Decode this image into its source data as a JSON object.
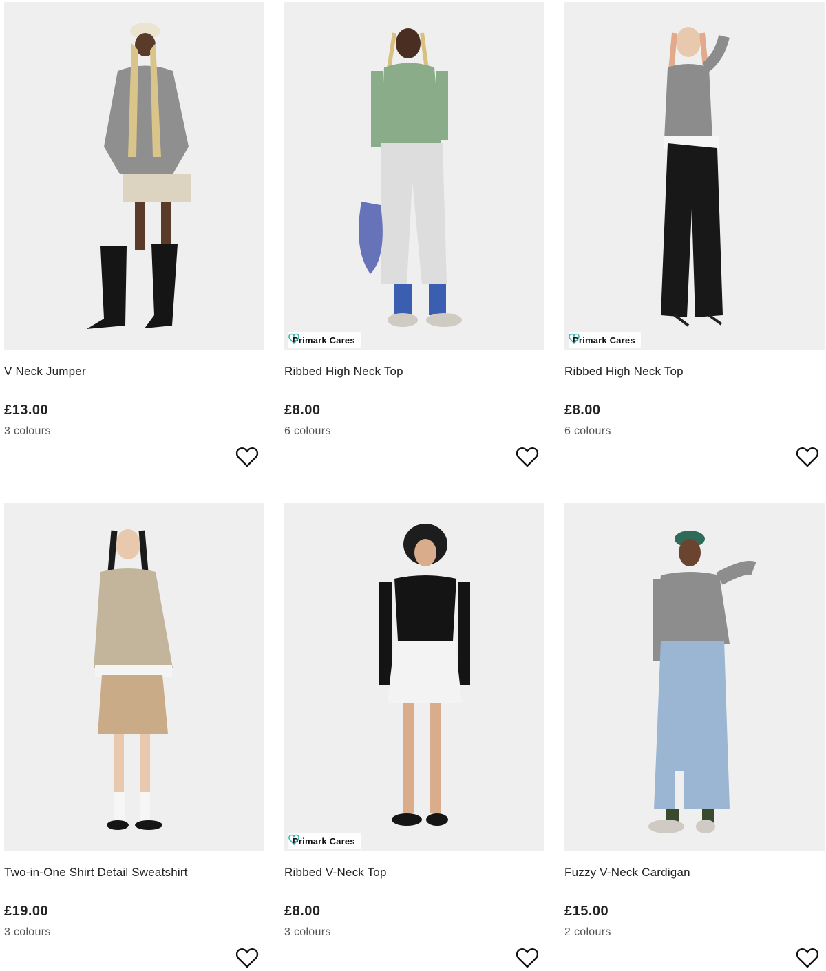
{
  "products": [
    {
      "name": "V Neck Jumper",
      "price": "£13.00",
      "colours": "3 colours",
      "badge": "",
      "image": "model-grey-v-neck-jumper-beige-shorts-black-boots"
    },
    {
      "name": "Ribbed High Neck Top",
      "price": "£8.00",
      "colours": "6 colours",
      "badge": "Primark Cares",
      "image": "model-green-ribbed-top-grey-joggers"
    },
    {
      "name": "Ribbed High Neck Top",
      "price": "£8.00",
      "colours": "6 colours",
      "badge": "Primark Cares",
      "image": "model-grey-ribbed-top-black-wide-trousers"
    },
    {
      "name": "Two-in-One Shirt Detail Sweatshirt",
      "price": "£19.00",
      "colours": "3 colours",
      "badge": "",
      "image": "model-beige-sweatshirt-pleated-mini-skirt"
    },
    {
      "name": "Ribbed V-Neck Top",
      "price": "£8.00",
      "colours": "3 colours",
      "badge": "Primark Cares",
      "image": "model-black-top-white-denim-mini-skirt"
    },
    {
      "name": "Fuzzy V-Neck Cardigan",
      "price": "£15.00",
      "colours": "2 colours",
      "badge": "",
      "image": "model-grey-cardigan-denim-midi-skirt-green-cap"
    }
  ],
  "icons": {
    "wishlist": "heart-outline-icon",
    "badge": "heart-leaf-icon"
  },
  "colors": {
    "badge_icon": "#3db5b0",
    "photo_bg": "#efefef",
    "text": "#222222",
    "muted": "#555555"
  }
}
